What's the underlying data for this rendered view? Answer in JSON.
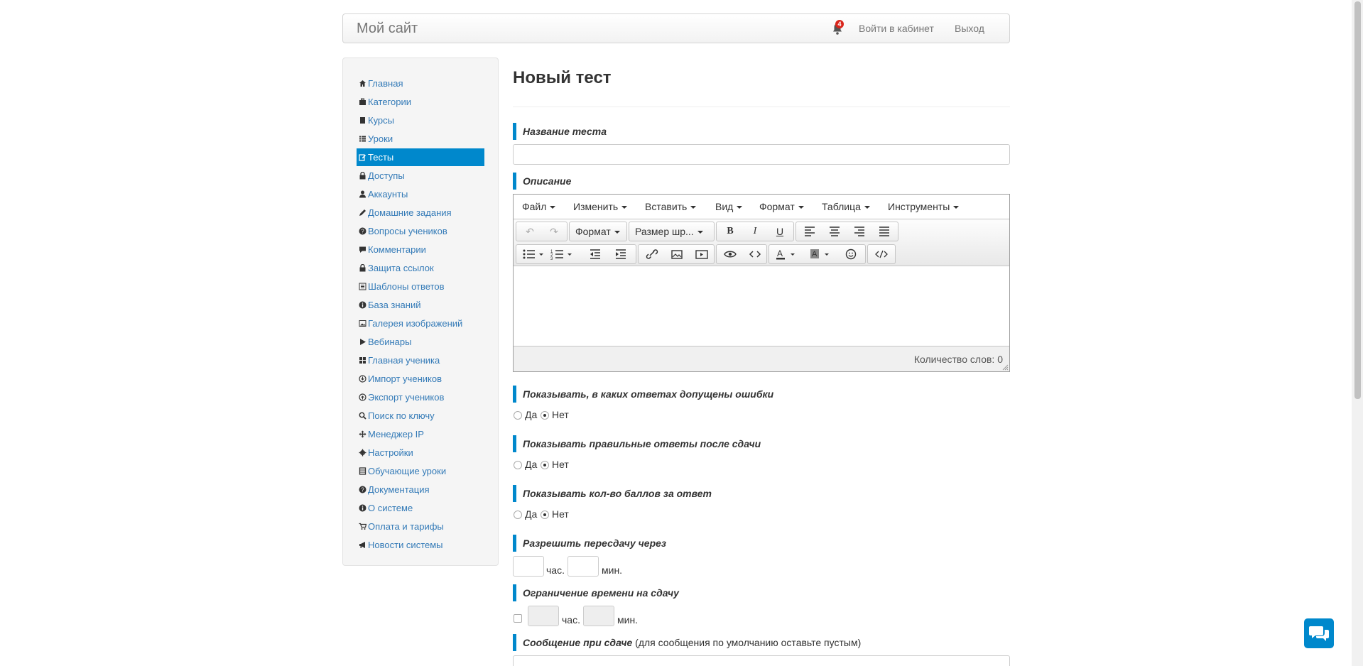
{
  "navbar": {
    "brand": "Мой сайт",
    "notifications": "4",
    "login": "Войти в кабинет",
    "logout": "Выход"
  },
  "sidebar": {
    "items": [
      {
        "label": "Главная",
        "icon": "home-icon"
      },
      {
        "label": "Категории",
        "icon": "briefcase-icon"
      },
      {
        "label": "Курсы",
        "icon": "book-icon"
      },
      {
        "label": "Уроки",
        "icon": "list-icon"
      },
      {
        "label": "Тесты",
        "icon": "edit-icon",
        "active": true
      },
      {
        "label": "Доступы",
        "icon": "lock-icon"
      },
      {
        "label": "Аккаунты",
        "icon": "user-icon"
      },
      {
        "label": "Домашние задания",
        "icon": "pencil-icon"
      },
      {
        "label": "Вопросы учеников",
        "icon": "question-icon"
      },
      {
        "label": "Комментарии",
        "icon": "comment-icon"
      },
      {
        "label": "Защита ссылок",
        "icon": "lock-icon"
      },
      {
        "label": "Шаблоны ответов",
        "icon": "list-alt-icon"
      },
      {
        "label": "База знаний",
        "icon": "info-icon"
      },
      {
        "label": "Галерея изображений",
        "icon": "picture-icon"
      },
      {
        "label": "Вебинары",
        "icon": "play-icon"
      },
      {
        "label": "Главная ученика",
        "icon": "th-large-icon"
      },
      {
        "label": "Импорт учеников",
        "icon": "import-icon"
      },
      {
        "label": "Экспорт учеников",
        "icon": "export-icon"
      },
      {
        "label": "Поиск по ключу",
        "icon": "search-icon"
      },
      {
        "label": "Менеджер IP",
        "icon": "move-icon"
      },
      {
        "label": "Настройки",
        "icon": "cog-icon"
      },
      {
        "label": "Обучающие уроки",
        "icon": "film-icon"
      },
      {
        "label": "Документация",
        "icon": "question-icon"
      },
      {
        "label": "О системе",
        "icon": "info-icon"
      },
      {
        "label": "Оплата и тарифы",
        "icon": "cart-icon"
      },
      {
        "label": "Новости системы",
        "icon": "bullhorn-icon"
      }
    ]
  },
  "page": {
    "title": "Новый тест"
  },
  "form": {
    "name_label": "Название теста",
    "description_label": "Описание",
    "editor": {
      "menus": [
        "Файл",
        "Изменить",
        "Вставить",
        "Вид",
        "Формат",
        "Таблица",
        "Инструменты"
      ],
      "format_label": "Формат",
      "font_size_label": "Размер шр...",
      "word_count": "Количество слов: 0"
    },
    "show_errors": {
      "label": "Показывать, в каких ответах допущены ошибки",
      "yes": "Да",
      "no": "Нет",
      "value": "Нет"
    },
    "show_correct": {
      "label": "Показывать правильные ответы после сдачи",
      "yes": "Да",
      "no": "Нет",
      "value": "Нет"
    },
    "show_points": {
      "label": "Показывать кол-во баллов за ответ",
      "yes": "Да",
      "no": "Нет",
      "value": "Нет"
    },
    "retake": {
      "label": "Разрешить пересдачу через",
      "hours_unit": "час.",
      "minutes_unit": "мин.",
      "hours": "",
      "minutes": ""
    },
    "time_limit": {
      "label": "Ограничение времени на сдачу",
      "hours_unit": "час.",
      "minutes_unit": "мин.",
      "enabled": false
    },
    "message": {
      "label": "Сообщение при сдаче",
      "hint": "(для сообщения по умолчанию оставьте пустым)"
    }
  },
  "colors": {
    "accent": "#0088cc",
    "link": "#337ab7",
    "badge": "#d9261c"
  }
}
